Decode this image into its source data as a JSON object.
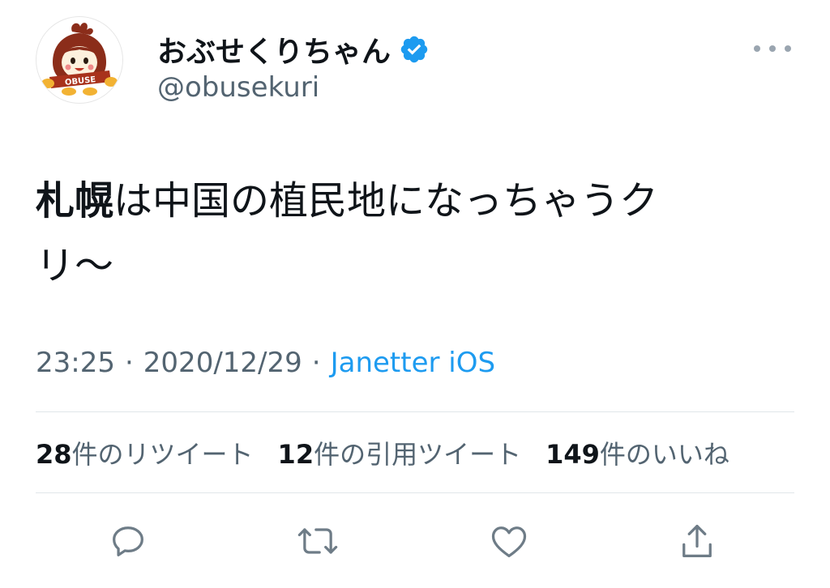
{
  "user": {
    "display_name": "おぶせくりちゃん",
    "handle": "@obusekuri",
    "verified": true,
    "avatar_text": "OBUSE"
  },
  "tweet": {
    "text_bold": "札幌",
    "text_rest_line1": "は中国の植民地になっちゃうク",
    "text_line2": "リ～",
    "time": "23:25",
    "date": "2020/12/29",
    "separator": "·",
    "source": "Janetter iOS"
  },
  "stats": {
    "retweets_num": "28",
    "retweets_label": "件のリツイート",
    "quotes_num": "12",
    "quotes_label": "件の引用ツイート",
    "likes_num": "149",
    "likes_label": "件のいいね"
  },
  "icons": {
    "more": "more-icon",
    "reply": "reply-icon",
    "retweet": "retweet-icon",
    "like": "like-icon",
    "share": "share-icon",
    "verified": "verified-badge-icon"
  },
  "colors": {
    "text": "#0f1419",
    "secondary": "#536471",
    "link": "#1d9bf0",
    "verified": "#1d9bf0",
    "icon": "#6e7c87"
  }
}
